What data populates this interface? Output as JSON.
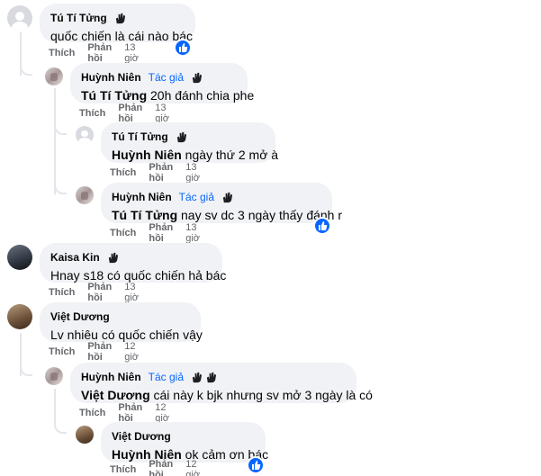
{
  "labels": {
    "like": "Thích",
    "reply": "Phản hồi",
    "author_badge": "Tác giả"
  },
  "colors": {
    "bubble": "#f0f2f5",
    "author_badge": "#0866ff",
    "meta_text": "#65676b",
    "reaction": "#0866ff"
  },
  "comments": [
    {
      "name": "Tú Tí Tửng",
      "mention": "",
      "text": "quốc chiến là cái nào bác",
      "time": "13 giờ",
      "avatar": "default-avatar",
      "reaction": "like"
    },
    {
      "name": "Huỳnh Niên",
      "mention": "Tú Tí Tửng",
      "text": "20h đánh chia phe",
      "time": "13 giờ",
      "avatar": "tile-avatar",
      "author": true
    },
    {
      "name": "Tú Tí Tửng",
      "mention": "Huỳnh Niên",
      "text": "ngày thứ 2 mở à",
      "time": "13 giờ",
      "avatar": "default-avatar"
    },
    {
      "name": "Huỳnh Niên",
      "mention": "Tú Tí Tửng",
      "text": "nay sv dc 3 ngày thấy đánh r",
      "time": "13 giờ",
      "avatar": "tile-avatar",
      "author": true,
      "reaction": "like"
    },
    {
      "name": "Kaisa Kin",
      "mention": "",
      "text": "Hnay s18 có quốc chiến hả bác",
      "time": "13 giờ",
      "avatar": "dark-avatar"
    },
    {
      "name": "Việt Dương",
      "mention": "",
      "text": "Lv nhiêu có quốc chiến vậy",
      "time": "12 giờ",
      "avatar": "photo-avatar"
    },
    {
      "name": "Huỳnh Niên",
      "mention": "Việt Dương",
      "text": "cái này k bjk nhưng sv mở 3 ngày là có",
      "time": "12 giờ",
      "avatar": "tile-avatar",
      "author": true
    },
    {
      "name": "Việt Dương",
      "mention": "Huỳnh Niên",
      "text": "ok cảm ơn bác",
      "time": "12 giờ",
      "avatar": "photo-avatar",
      "reaction": "like"
    }
  ]
}
